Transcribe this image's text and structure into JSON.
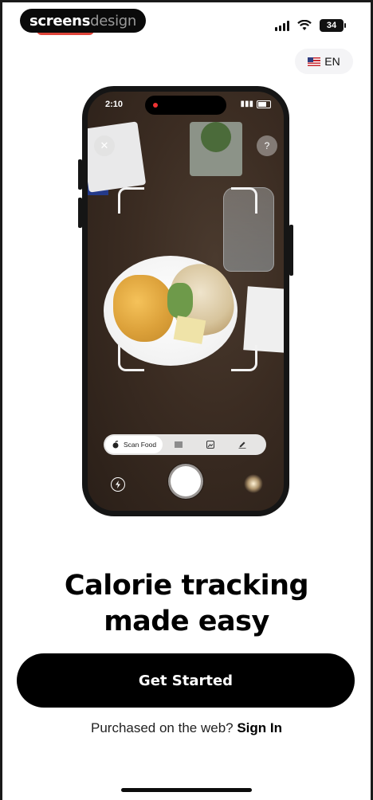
{
  "watermark": {
    "bold": "screens",
    "light": "design"
  },
  "status_bar": {
    "battery": "34",
    "signal_icon": "cellular-signal-icon",
    "wifi_icon": "wifi-icon"
  },
  "language": {
    "flag_icon": "us-flag-icon",
    "code": "EN"
  },
  "mockup": {
    "time": "2:10",
    "scan_modes": {
      "active_label": "Scan Food",
      "icons": [
        "barcode-scan-icon",
        "image-icon",
        "pencil-icon"
      ]
    },
    "buttons": {
      "close": "✕",
      "help": "?"
    }
  },
  "main": {
    "headline_line1": "Calorie tracking",
    "headline_line2": "made easy",
    "cta_label": "Get Started",
    "signin_prompt": "Purchased on the web?",
    "signin_link": "Sign In"
  },
  "colors": {
    "primary": "#000000",
    "background": "#ffffff",
    "pill_bg": "#f4f4f6"
  }
}
